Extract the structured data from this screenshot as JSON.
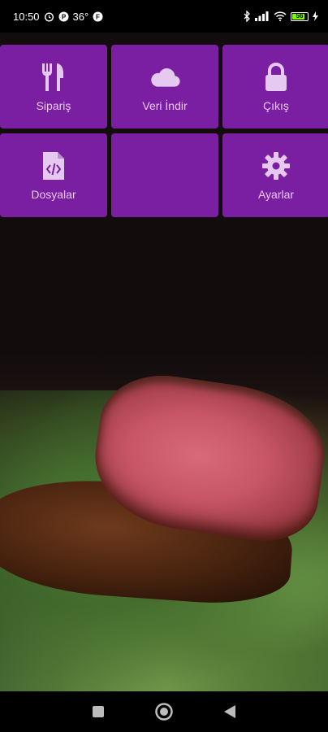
{
  "status_bar": {
    "time": "10:50",
    "temperature": "36°",
    "battery_level": "56"
  },
  "menu": {
    "tiles": [
      {
        "label": "Sipariş",
        "icon": "fork-knife-icon"
      },
      {
        "label": "Veri İndir",
        "icon": "cloud-icon"
      },
      {
        "label": "Çıkış",
        "icon": "lock-icon"
      },
      {
        "label": "Dosyalar",
        "icon": "code-file-icon"
      },
      {
        "label": "",
        "icon": ""
      },
      {
        "label": "Ayarlar",
        "icon": "gear-icon"
      }
    ]
  },
  "colors": {
    "tile": "#7b1fa2",
    "tile_text": "#e6c9f0",
    "icon": "#e6c9f0"
  },
  "nav_bar": {
    "buttons": [
      "recents-square-icon",
      "home-circle-icon",
      "back-triangle-icon"
    ]
  }
}
